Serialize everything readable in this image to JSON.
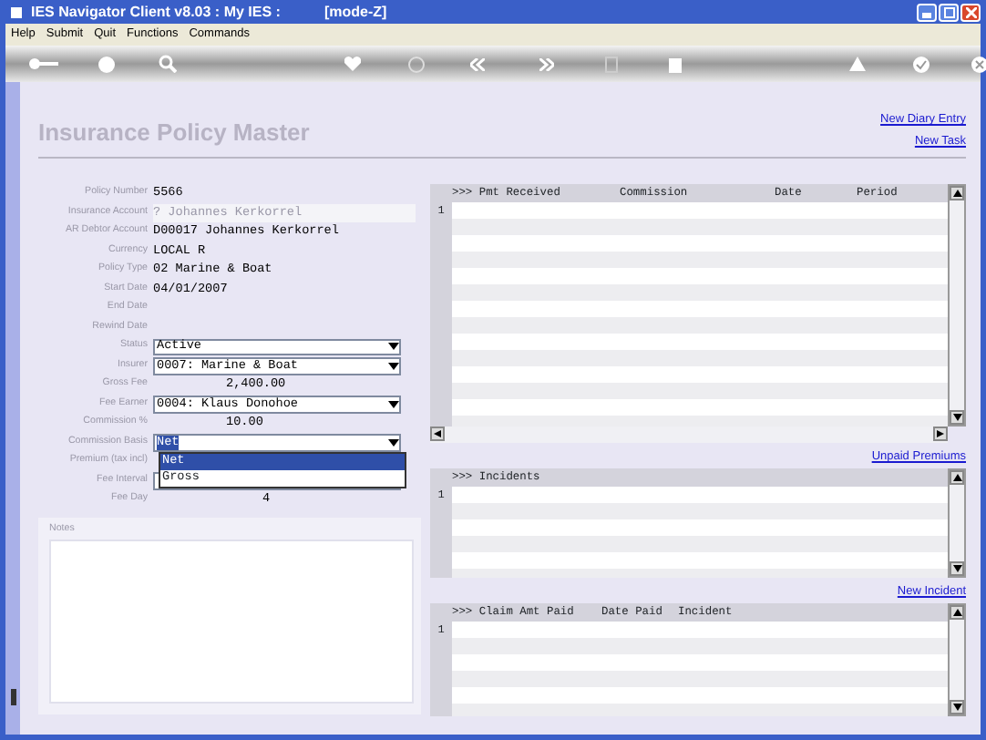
{
  "window": {
    "title": "IES Navigator Client v8.03 : My IES :",
    "mode": "[mode-Z]"
  },
  "menu": [
    "Help",
    "Submit",
    "Quit",
    "Functions",
    "Commands"
  ],
  "page": {
    "title": "Insurance Policy Master",
    "links": [
      "New Diary Entry",
      "New Task"
    ]
  },
  "fields": [
    {
      "label": "Policy Number",
      "value": "5566",
      "kind": "text"
    },
    {
      "label": "Insurance Account",
      "value": "? Johannes Kerkorrel",
      "kind": "lookup"
    },
    {
      "label": "AR Debtor Account",
      "value": "D00017 Johannes Kerkorrel",
      "kind": "text"
    },
    {
      "label": "Currency",
      "value": "LOCAL R",
      "kind": "text"
    },
    {
      "label": "Policy Type",
      "value": "02 Marine & Boat",
      "kind": "text"
    },
    {
      "label": "Start Date",
      "value": "04/01/2007",
      "kind": "text"
    },
    {
      "label": "End Date",
      "kind": "text"
    },
    {
      "label": "Rewind Date",
      "kind": "text"
    },
    {
      "label": "Status",
      "value": "Active",
      "kind": "select"
    },
    {
      "label": "Insurer",
      "value": "0007: Marine & Boat",
      "kind": "select"
    },
    {
      "label": "Gross Fee",
      "value": "2,400.00",
      "kind": "amount"
    },
    {
      "label": "Fee Earner",
      "value": "0004: Klaus Donohoe",
      "kind": "select"
    },
    {
      "label": "Commission %",
      "value": "10.00",
      "kind": "amount"
    },
    {
      "label": "Commission Basis",
      "value": "Net",
      "kind": "select",
      "focused": true,
      "options": [
        {
          "label": "Net",
          "selected": true
        },
        {
          "label": "Gross",
          "selected": false
        }
      ]
    },
    {
      "label": "Premium (tax incl)",
      "kind": "hidden"
    },
    {
      "label": "Fee Interval",
      "kind": "covered-select"
    },
    {
      "label": "Fee Day",
      "value": "4",
      "kind": "center"
    }
  ],
  "notes": {
    "label": "Notes"
  },
  "grids": [
    {
      "columns": [
        ">>> Pmt Received",
        "Commission",
        "Date",
        "Period"
      ],
      "rows": [
        "1"
      ],
      "link": "Unpaid Premiums"
    },
    {
      "columns": [
        ">>> Incidents"
      ],
      "rows": [
        "1"
      ],
      "link": "New Incident"
    },
    {
      "columns": [
        ">>> Claim Amt Paid",
        "Date Paid",
        "Incident"
      ],
      "rows": [
        "1"
      ]
    }
  ]
}
